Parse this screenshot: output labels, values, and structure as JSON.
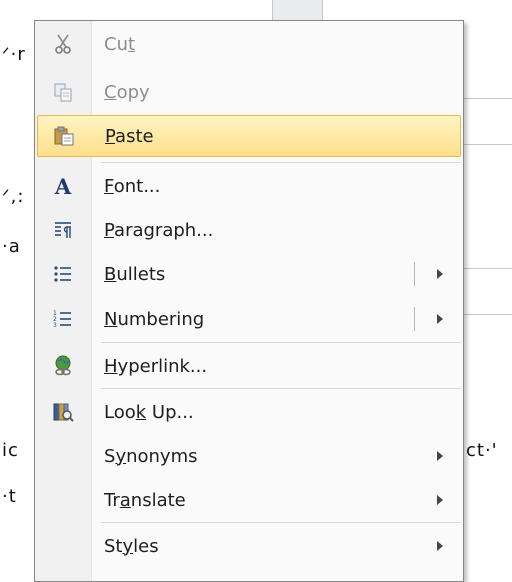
{
  "document": {
    "frag1": "ᐟ·r",
    "frag2": "ᐟ,:",
    "frag3": "·a",
    "frag4": "ic",
    "frag5": "·t",
    "frag6": "ct·'"
  },
  "menu": {
    "items": [
      {
        "pre": "Cu",
        "u": "t",
        "post": "",
        "state": "disabled",
        "icon": "scissors-icon"
      },
      {
        "pre": "",
        "u": "C",
        "post": "opy",
        "state": "disabled",
        "icon": "copy-icon"
      },
      {
        "pre": "",
        "u": "P",
        "post": "aste",
        "state": "highlighted",
        "icon": "paste-icon"
      },
      {
        "pre": "",
        "u": "F",
        "post": "ont...",
        "state": "normal",
        "icon": "font-icon"
      },
      {
        "pre": "",
        "u": "P",
        "post": "aragraph...",
        "state": "normal",
        "icon": "paragraph-icon"
      },
      {
        "pre": "",
        "u": "B",
        "post": "ullets",
        "state": "normal",
        "icon": "bullets-icon"
      },
      {
        "pre": "",
        "u": "N",
        "post": "umbering",
        "state": "normal",
        "icon": "numbering-icon"
      },
      {
        "pre": "",
        "u": "H",
        "post": "yperlink...",
        "state": "normal",
        "icon": "hyperlink-icon"
      },
      {
        "pre": "Loo",
        "u": "k",
        "post": " Up...",
        "state": "normal",
        "icon": "research-icon"
      },
      {
        "pre": "S",
        "u": "y",
        "post": "nonyms",
        "state": "normal",
        "icon": ""
      },
      {
        "pre": "Tr",
        "u": "a",
        "post": "nslate",
        "state": "normal",
        "icon": ""
      },
      {
        "pre": "St",
        "u": "y",
        "post": "les",
        "state": "normal",
        "icon": ""
      }
    ]
  }
}
